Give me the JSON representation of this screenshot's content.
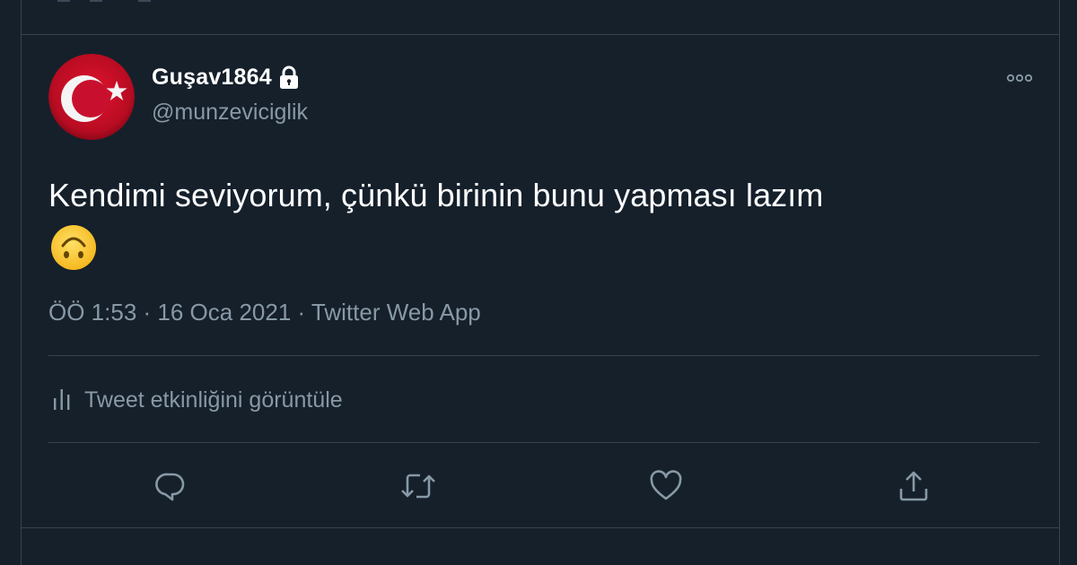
{
  "user": {
    "display_name": "Guşav1864",
    "handle": "@munzeviciglik",
    "protected_icon": "lock-icon",
    "avatar_desc_colors": {
      "primary": "#c8102e",
      "symbol": "#ffffff"
    }
  },
  "tweet": {
    "text": "Kendimi seviyorum, çünkü birinin bunu yapması lazım",
    "emoji_icon": "upside-down-face-icon",
    "time": "ÖÖ 1:53",
    "date": "16 Oca 2021",
    "source": "Twitter Web App",
    "separator": " · "
  },
  "activity": {
    "label": "Tweet etkinliğini görüntüle",
    "icon": "bar-chart-icon"
  },
  "actions": [
    {
      "name": "reply",
      "icon": "reply-icon"
    },
    {
      "name": "retweet",
      "icon": "retweet-icon"
    },
    {
      "name": "like",
      "icon": "heart-icon"
    },
    {
      "name": "share",
      "icon": "share-icon"
    }
  ],
  "colors": {
    "background": "#15202b",
    "border": "#38444d",
    "primary_text": "#ffffff",
    "secondary_text": "#8899a6"
  }
}
